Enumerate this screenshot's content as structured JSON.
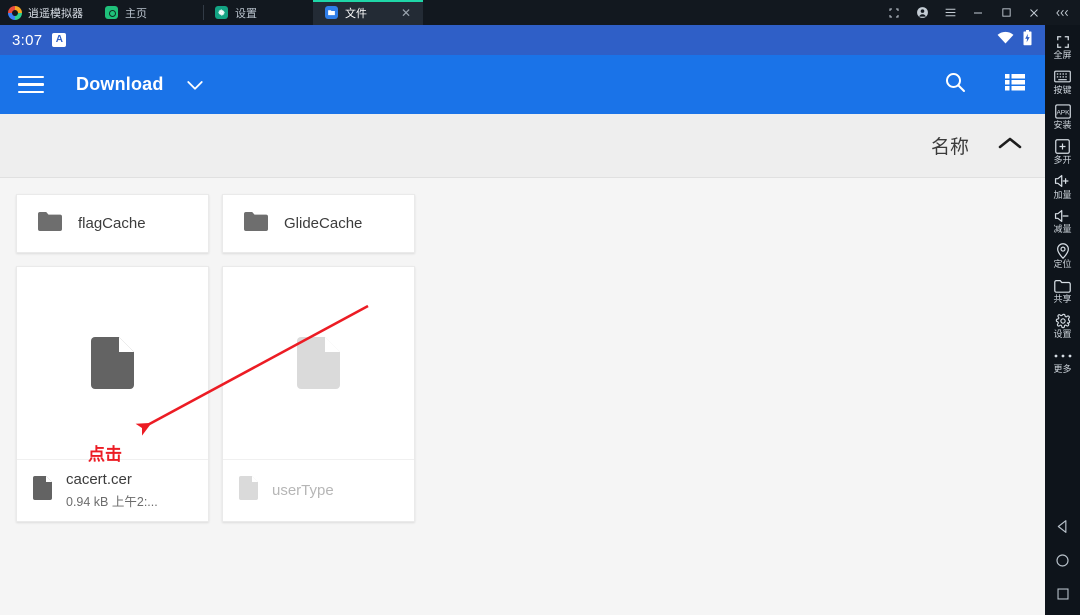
{
  "emulator": {
    "brand": "逍遥模拟器",
    "tabs": [
      {
        "label": "主页",
        "icon": "home-circle-icon",
        "active": false,
        "closable": false
      },
      {
        "label": "设置",
        "icon": "gear-icon",
        "active": false,
        "closable": false
      },
      {
        "label": "文件",
        "icon": "folder-blue-icon",
        "active": true,
        "closable": true
      }
    ],
    "close_glyph": "✕",
    "window_buttons": [
      {
        "name": "snapshot-button",
        "icon": "crop-frame-icon"
      },
      {
        "name": "account-button",
        "icon": "user-circle-icon"
      },
      {
        "name": "menu-button",
        "icon": "hamburger-icon"
      },
      {
        "name": "minimize-button",
        "icon": "minimize-icon"
      },
      {
        "name": "maximize-button",
        "icon": "maximize-icon"
      },
      {
        "name": "close-window-button",
        "icon": "close-icon"
      },
      {
        "name": "collapse-sidebar-button",
        "icon": "chevrons-left-icon"
      }
    ]
  },
  "statusbar": {
    "time": "3:07",
    "badge": "A",
    "wifi_icon": "wifi-icon",
    "battery_icon": "battery-charging-icon"
  },
  "appbar": {
    "menu_icon": "hamburger-icon",
    "title": "Download",
    "dropdown_icon": "chevron-down-icon",
    "search_icon": "search-icon",
    "view_icon": "list-view-icon"
  },
  "sortbar": {
    "label": "名称",
    "direction_icon": "chevron-up-icon"
  },
  "files": [
    {
      "type": "folder",
      "name": "flagCache",
      "icon": "folder-icon",
      "dimmed": false
    },
    {
      "type": "folder",
      "name": "GlideCache",
      "icon": "folder-icon",
      "dimmed": false
    },
    {
      "type": "file",
      "name": "cacert.cer",
      "meta": "0.94 kB 上午2:...",
      "icon": "file-icon",
      "dimmed": false
    },
    {
      "type": "file",
      "name": "userType",
      "meta": "",
      "icon": "file-icon",
      "dimmed": true
    }
  ],
  "annotation": {
    "text": "点击",
    "color": "#ec1c24",
    "arrow": "arrow-pointing-to-cacert-file"
  },
  "sidebar": {
    "items": [
      {
        "label": "全屏",
        "icon": "fullscreen-icon"
      },
      {
        "label": "按键",
        "icon": "keyboard-icon"
      },
      {
        "label": "安装",
        "icon": "apk-install-icon"
      },
      {
        "label": "多开",
        "icon": "multi-instance-icon"
      },
      {
        "label": "加量",
        "icon": "volume-up-icon"
      },
      {
        "label": "减量",
        "icon": "volume-down-icon"
      },
      {
        "label": "定位",
        "icon": "location-pin-icon"
      },
      {
        "label": "共享",
        "icon": "shared-folder-icon"
      },
      {
        "label": "设置",
        "icon": "gear-icon"
      },
      {
        "label": "更多",
        "icon": "ellipsis-icon"
      }
    ],
    "nav": [
      {
        "name": "android-back-button",
        "icon": "triangle-back-icon"
      },
      {
        "name": "android-home-button",
        "icon": "circle-home-icon"
      },
      {
        "name": "android-recents-button",
        "icon": "square-recents-icon"
      }
    ]
  },
  "colors": {
    "statusbar": "#2f5fc7",
    "appbar": "#1a73e8",
    "accent_tab": "#1fd6a8",
    "annotation": "#ec1c24"
  }
}
